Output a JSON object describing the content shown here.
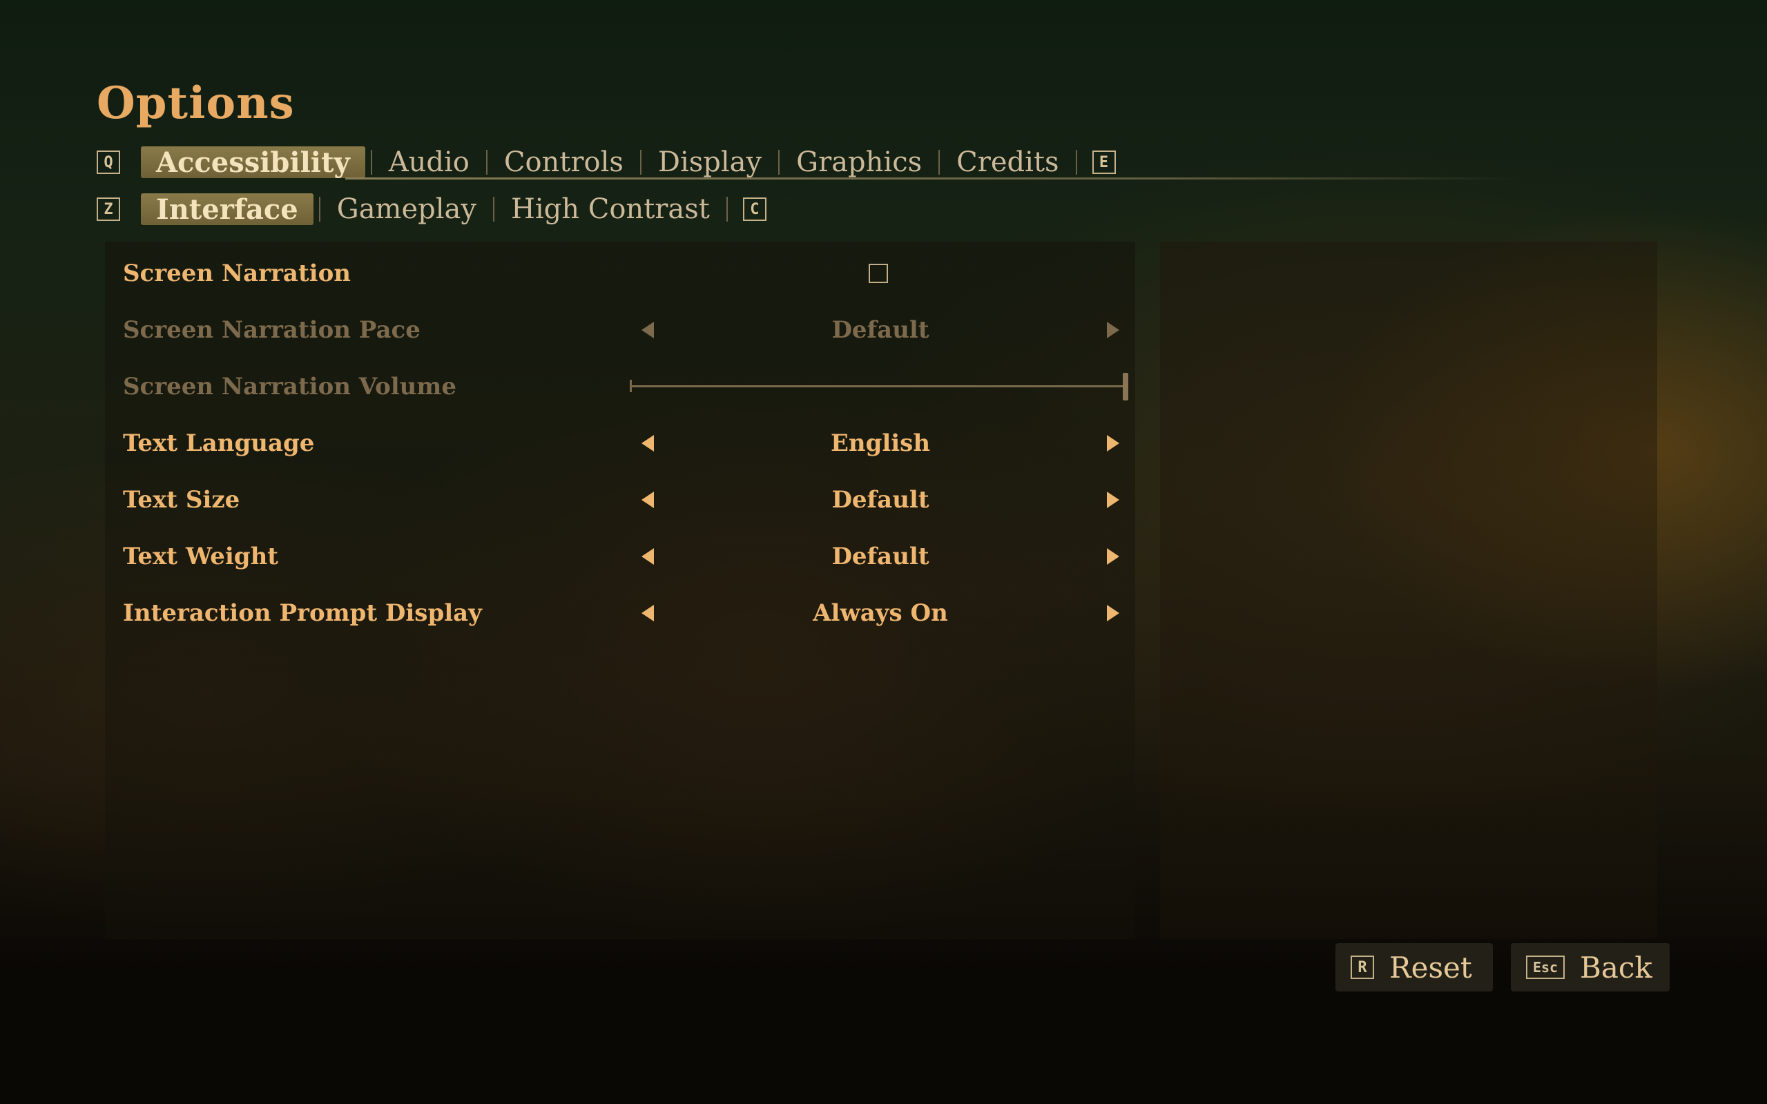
{
  "page": {
    "title": "Options"
  },
  "primary_tabs": {
    "prev_key": "Q",
    "next_key": "E",
    "items": [
      {
        "label": "Accessibility",
        "active": true
      },
      {
        "label": "Audio",
        "active": false
      },
      {
        "label": "Controls",
        "active": false
      },
      {
        "label": "Display",
        "active": false
      },
      {
        "label": "Graphics",
        "active": false
      },
      {
        "label": "Credits",
        "active": false
      }
    ]
  },
  "secondary_tabs": {
    "prev_key": "Z",
    "next_key": "C",
    "items": [
      {
        "label": "Interface",
        "active": true
      },
      {
        "label": "Gameplay",
        "active": false
      },
      {
        "label": "High Contrast",
        "active": false
      }
    ]
  },
  "settings": [
    {
      "label": "Screen Narration",
      "type": "checkbox",
      "checked": false,
      "enabled": true
    },
    {
      "label": "Screen Narration Pace",
      "type": "selector",
      "value": "Default",
      "enabled": false
    },
    {
      "label": "Screen Narration Volume",
      "type": "slider",
      "level": 1.0,
      "enabled": false
    },
    {
      "label": "Text Language",
      "type": "selector",
      "value": "English",
      "enabled": true
    },
    {
      "label": "Text Size",
      "type": "selector",
      "value": "Default",
      "enabled": true
    },
    {
      "label": "Text Weight",
      "type": "selector",
      "value": "Default",
      "enabled": true
    },
    {
      "label": "Interaction Prompt Display",
      "type": "selector",
      "value": "Always On",
      "enabled": true
    }
  ],
  "footer": {
    "reset": {
      "key": "R",
      "label": "Reset"
    },
    "back": {
      "key": "Esc",
      "label": "Back"
    }
  },
  "colors": {
    "accent": "#efb670",
    "title": "#e8aa62",
    "disabled": "#7d6a4c",
    "active_tab_bg": "#7d6d40"
  }
}
